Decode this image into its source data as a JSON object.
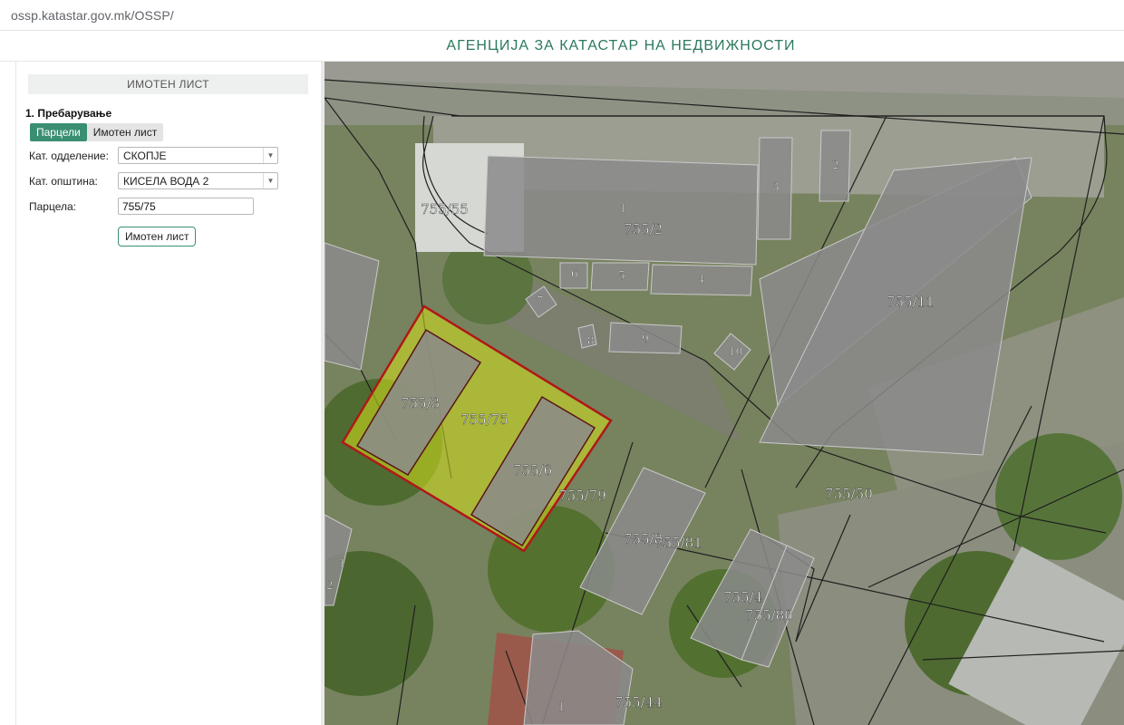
{
  "browser": {
    "url": "ossp.katastar.gov.mk/OSSP/"
  },
  "header": {
    "title": "АГЕНЦИЈА ЗА КАТАСТАР НА НЕДВИЖНОСТИ"
  },
  "panel": {
    "heading": "ИМОТЕН ЛИСТ",
    "section_title": "1. Пребарување",
    "tabs": [
      {
        "label": "Парцели",
        "active": true
      },
      {
        "label": "Имотен лист",
        "active": false
      }
    ],
    "fields": {
      "department_label": "Кат. одделение:",
      "department_value": "СКОПЈЕ",
      "municipality_label": "Кат. општина:",
      "municipality_value": "КИСЕЛА ВОДА 2",
      "parcel_label": "Парцела:",
      "parcel_value": "755/75"
    },
    "submit_label": "Имотен лист"
  },
  "map": {
    "parcel_labels": [
      "755/55",
      "755/2",
      "755/11",
      "755/3",
      "755/75",
      "755/6",
      "755/79",
      "755/50",
      "755/8",
      "755/81",
      "755/4",
      "755/80",
      "755/44"
    ],
    "building_numbers": [
      "1",
      "2",
      "3",
      "4",
      "5",
      "6",
      "7",
      "8",
      "9",
      "10",
      "1",
      "1",
      "2"
    ],
    "colors": {
      "selected_fill": "#d6e21a",
      "selected_outline": "#b01818",
      "building_fill": "#8a8a8a"
    }
  }
}
